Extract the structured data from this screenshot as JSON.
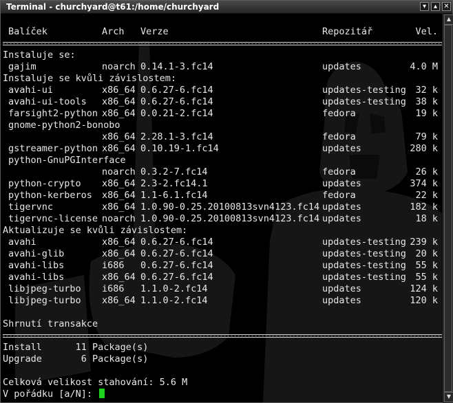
{
  "window": {
    "title": "Terminal - churchyard@t61:/home/churchyard"
  },
  "buttons": {
    "minimize": "▾",
    "maximize": "▴",
    "close": "✕"
  },
  "header": {
    "package": "Balíček",
    "arch": "Arch",
    "version": "Verze",
    "repo": "Repozitář",
    "size": "Vel."
  },
  "sections": {
    "installing": "Instaluje se:",
    "deps": "Instaluje se kvůli závislostem:",
    "updating": "Aktualizuje se kvůli závislostem:",
    "summary": "Shrnutí transakce"
  },
  "installing": [
    {
      "name": "gajim",
      "arch": "noarch",
      "version": "0.14.1-3.fc14",
      "repo": "updates",
      "size": "4.0 M"
    }
  ],
  "deps": [
    {
      "name": "avahi-ui",
      "arch": "x86_64",
      "version": "0.6.27-6.fc14",
      "repo": "updates-testing",
      "size": "32 k"
    },
    {
      "name": "avahi-ui-tools",
      "arch": "x86_64",
      "version": "0.6.27-6.fc14",
      "repo": "updates-testing",
      "size": "38 k"
    },
    {
      "name": "farsight2-python",
      "arch": "x86_64",
      "version": "0.0.21-2.fc14",
      "repo": "fedora",
      "size": "19 k"
    },
    {
      "name": "gnome-python2-bonobo",
      "arch": "",
      "version": "",
      "repo": "",
      "size": ""
    },
    {
      "name": "",
      "arch": "x86_64",
      "version": "2.28.1-3.fc14",
      "repo": "fedora",
      "size": "79 k"
    },
    {
      "name": "gstreamer-python",
      "arch": "x86_64",
      "version": "0.10.19-1.fc14",
      "repo": "updates",
      "size": "280 k"
    },
    {
      "name": "python-GnuPGInterface",
      "arch": "",
      "version": "",
      "repo": "",
      "size": ""
    },
    {
      "name": "",
      "arch": "noarch",
      "version": "0.3.2-7.fc14",
      "repo": "fedora",
      "size": "26 k"
    },
    {
      "name": "python-crypto",
      "arch": "x86_64",
      "version": "2.3-2.fc14.1",
      "repo": "updates",
      "size": "374 k"
    },
    {
      "name": "python-kerberos",
      "arch": "x86_64",
      "version": "1.1-6.1.fc14",
      "repo": "fedora",
      "size": "22 k"
    },
    {
      "name": "tigervnc",
      "arch": "x86_64",
      "version": "1.0.90-0.25.20100813svn4123.fc14",
      "repo": "updates",
      "size": "182 k"
    },
    {
      "name": "tigervnc-license",
      "arch": "noarch",
      "version": "1.0.90-0.25.20100813svn4123.fc14",
      "repo": "updates",
      "size": "18 k"
    }
  ],
  "updates": [
    {
      "name": "avahi",
      "arch": "x86_64",
      "version": "0.6.27-6.fc14",
      "repo": "updates-testing",
      "size": "239 k"
    },
    {
      "name": "avahi-glib",
      "arch": "x86_64",
      "version": "0.6.27-6.fc14",
      "repo": "updates-testing",
      "size": "20 k"
    },
    {
      "name": "avahi-libs",
      "arch": "i686",
      "version": "0.6.27-6.fc14",
      "repo": "updates-testing",
      "size": "55 k"
    },
    {
      "name": "avahi-libs",
      "arch": "x86_64",
      "version": "0.6.27-6.fc14",
      "repo": "updates-testing",
      "size": "55 k"
    },
    {
      "name": "libjpeg-turbo",
      "arch": "i686",
      "version": "1.1.0-2.fc14",
      "repo": "updates",
      "size": "124 k"
    },
    {
      "name": "libjpeg-turbo",
      "arch": "x86_64",
      "version": "1.1.0-2.fc14",
      "repo": "updates",
      "size": "120 k"
    }
  ],
  "summary": {
    "install": "Install      11 Package(s)",
    "upgrade": "Upgrade       6 Package(s)",
    "total": "Celková velikost stahování: 5.6 M",
    "prompt": "V pořádku [a/N]: "
  },
  "colors": {
    "cursor": "#1fd21f",
    "text": "#e8e8e8",
    "background": "#000000"
  }
}
